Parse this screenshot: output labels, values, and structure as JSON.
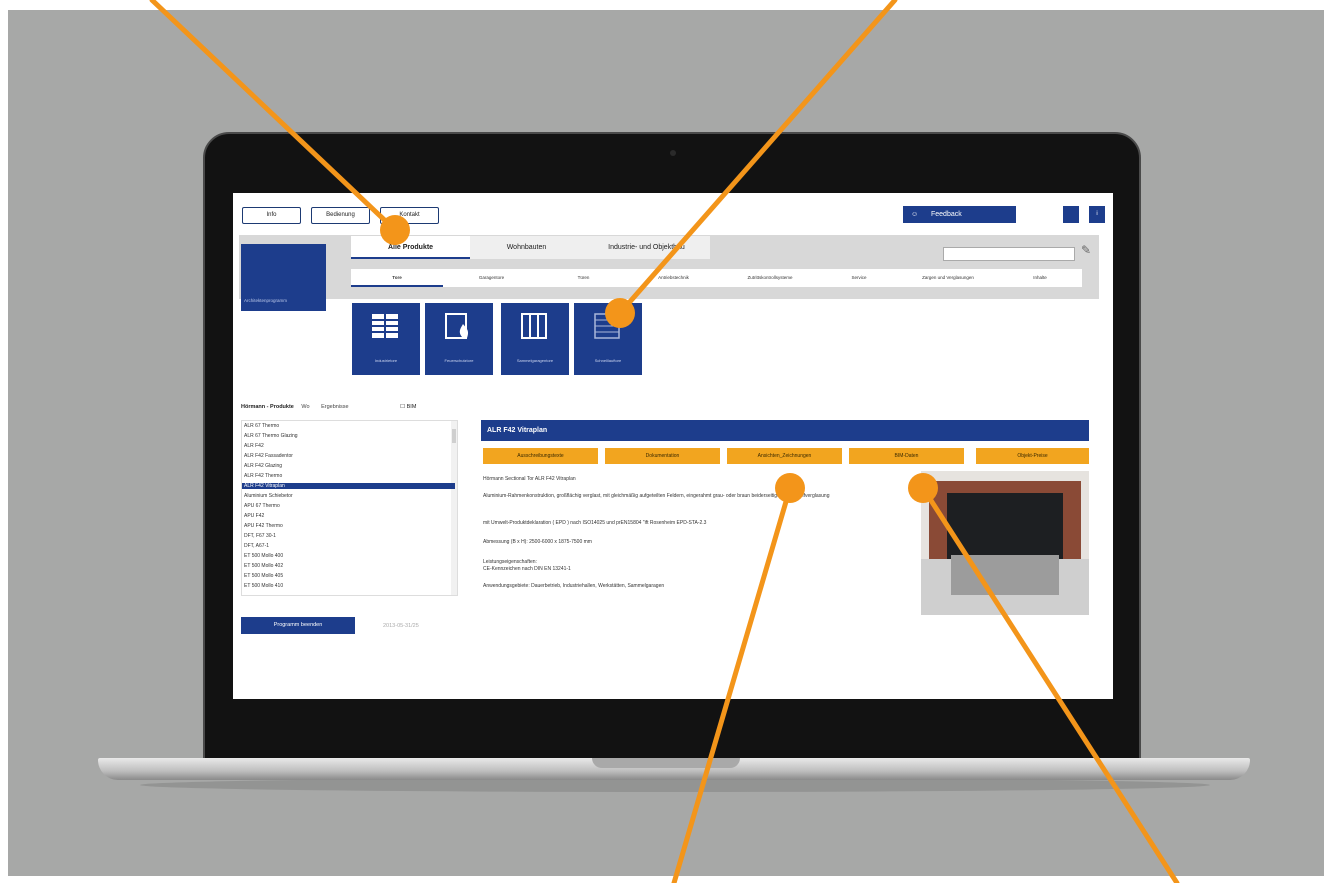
{
  "topbar": {
    "buttons": [
      "Info",
      "Bedienung",
      "Kontakt"
    ],
    "feedback_label": "Feedback",
    "feedback_icon": "smiley-icon",
    "small_buttons": [
      "",
      "i"
    ]
  },
  "logo": {
    "text": "Architektenprogramm"
  },
  "main_tabs": [
    "Alle Produkte",
    "Wohnbauten",
    "Industrie- und Objektbau"
  ],
  "sub_tabs": [
    "Tore",
    "Garagentore",
    "Türen",
    "Antriebstechnik",
    "Zutrittskontrollsysteme",
    "Service",
    "Zargen und Verglasungen",
    "Inhalte"
  ],
  "tiles": [
    "Industrietore",
    "Feuerschutztore",
    "Sammelgaragentore",
    "Schnelllauftore"
  ],
  "list": {
    "header": {
      "title": "Hörmann - Produkte",
      "options": [
        "Wo",
        "Ergebnisse"
      ],
      "checkbox": "BIM"
    },
    "items": [
      "ALR 67 Thermo",
      "ALR 67 Thermo Glazing",
      "ALR F42",
      "ALR F42 Fassadentor",
      "ALR F42 Glazing",
      "ALR F42 Thermo",
      "ALR F42 Vitraplan",
      "Aluminium Schiebetor",
      "APU 67 Thermo",
      "APU F42",
      "APU F42 Thermo",
      "DFT, F67 30-1",
      "DFT, A67-1",
      "ET 500 Mollo 400",
      "ET 500 Mollo 402",
      "ET 500 Mollo 405",
      "ET 500 Mollo 410"
    ],
    "selected_index": 6
  },
  "program_button": "Programm beenden",
  "date": "2013-05-31/25",
  "product": {
    "title": "ALR F42 Vitraplan",
    "actions": [
      "Ausschreibungstexte",
      "Dokumentation",
      "Ansichten_Zeichnungen",
      "BIM-Daten",
      "Objekt-Preise"
    ],
    "desc": [
      "Hörmann Sectional Tor ALR F42 Vitraplan",
      "Aluminium-Rahmenkonstruktion, großflächig verglast, mit gleichmäßig aufgeteilten Feldern, eingerahmt grau- oder braun beiderseitiger Kunststoffverglasung",
      "mit Umwelt-Produktdeklaration ( EPD ) nach ISO14025 und prEN15804 \"ift Rosenheim EPD-STA-2.3",
      "Abmessung (B x H): 2500-6000 x 1875-7500 mm",
      "Leistungseigenschaften:",
      "CE-Kennzeichen nach DIN EN 13241-1",
      "Anwendungsgebiete: Dauerbetrieb, Industriehallen, Werkstätten, Sammelgaragen"
    ]
  },
  "colors": {
    "primary": "#1d3d8c",
    "accent": "#f2a51f",
    "callout": "#f3951a"
  }
}
